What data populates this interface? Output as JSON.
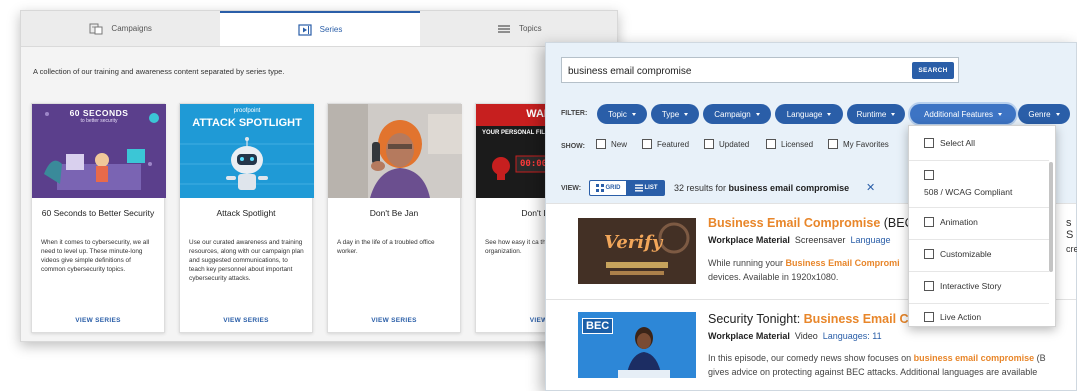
{
  "back_panel": {
    "tabs": [
      {
        "label": "Campaigns",
        "icon": "campaigns-icon"
      },
      {
        "label": "Series",
        "icon": "series-icon",
        "active": true
      },
      {
        "label": "Topics",
        "icon": "topics-list-icon"
      }
    ],
    "intro": "A collection of our training and awareness content separated by series type.",
    "cards": [
      {
        "thumb_caption": "60 SECONDS",
        "thumb_sub": "to better security",
        "title": "60 Seconds to Better Security",
        "description": "When it comes to cybersecurity, we all need to level up. These minute-long videos give simple definitions of common cybersecurity topics.",
        "link": "VIEW SERIES"
      },
      {
        "thumb_brand": "proofpoint",
        "thumb_caption": "ATTACK SPOTLIGHT",
        "title": "Attack Spotlight",
        "description": "Use our curated awareness and training resources, along with our campaign plan and suggested communications, to teach key personnel about important cybersecurity attacks.",
        "link": "VIEW SERIES"
      },
      {
        "title": "Don't Be Jan",
        "description": "A day in the life of a troubled office worker.",
        "link": "VIEW SERIES"
      },
      {
        "thumb_caption": "WARN",
        "thumb_sub": "YOUR PERSONAL FILES A",
        "thumb_timer": "00:00",
        "title": "Don't Let T",
        "description": "See how easy it ca thieves in to your c organization.",
        "link": "VIEW S"
      }
    ]
  },
  "search": {
    "query": "business email compromise",
    "button": "SEARCH"
  },
  "filters": {
    "label": "FILTER:",
    "pills": [
      "Topic",
      "Type",
      "Campaign",
      "Language",
      "Runtime",
      "Additional Features",
      "Genre"
    ]
  },
  "show": {
    "label": "SHOW:",
    "options": [
      "New",
      "Featured",
      "Updated",
      "Licensed",
      "My Favorites"
    ]
  },
  "view": {
    "label": "VIEW:",
    "grid": "GRID",
    "list": "LIST",
    "results_count": "32 results for",
    "results_query": "business email compromise"
  },
  "results": [
    {
      "title_hl": "Business Email Compromise",
      "title_rest": " (BEC) S",
      "type": "Workplace Material",
      "format": "Screensaver",
      "lang": "Language",
      "thumb_caption": "Verify",
      "desc1_pre": "While running your ",
      "desc1_hl": "Business Email Compromi",
      "desc2": "devices. Available in 1920x1080."
    },
    {
      "title_pre": "Security Tonight: ",
      "title_hl": "Business Email Co",
      "type": "Workplace Material",
      "format": "Video",
      "lang": "Languages: 11",
      "thumb_caption": "BEC",
      "desc1_pre": "In this episode, our comedy news show focuses on ",
      "desc1_hl": "business email compromise",
      "desc1_post": " (B",
      "desc2": "gives advice on protecting against BEC attacks. Additional languages are available"
    }
  ],
  "dropdown": {
    "items": [
      "Select All",
      "508 / WCAG Compliant",
      "Animation",
      "Customizable",
      "Interactive Story",
      "Live Action"
    ]
  },
  "edge_fragments": [
    "s S",
    "cre"
  ]
}
